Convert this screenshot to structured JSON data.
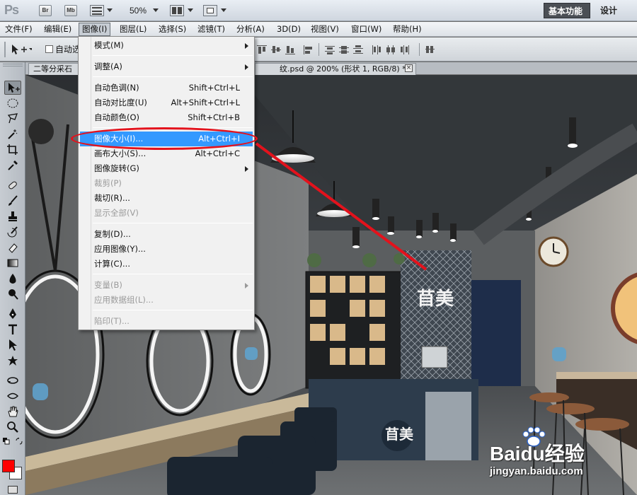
{
  "appbar": {
    "logo": "Ps",
    "bridge_label": "Br",
    "minibridge_label": "Mb",
    "zoom_level": "50%",
    "workspace_active": "基本功能",
    "workspace_other": "设计"
  },
  "menubar": {
    "items": [
      {
        "label": "文件(F)"
      },
      {
        "label": "编辑(E)"
      },
      {
        "label": "图像(I)"
      },
      {
        "label": "图层(L)"
      },
      {
        "label": "选择(S)"
      },
      {
        "label": "滤镜(T)"
      },
      {
        "label": "分析(A)"
      },
      {
        "label": "3D(D)"
      },
      {
        "label": "视图(V)"
      },
      {
        "label": "窗口(W)"
      },
      {
        "label": "帮助(H)"
      }
    ]
  },
  "options_bar": {
    "autoselect_label": "自动选"
  },
  "tabs": {
    "tab1_label": "二等分采石",
    "tab2_label": "纹.psd @ 200% (形状 1, RGB/8) *",
    "close_glyph": "×"
  },
  "image_menu": {
    "items": [
      {
        "label": "模式(M)",
        "shortcut": "",
        "submenu": true,
        "disabled": false
      },
      {
        "label": "调整(A)",
        "shortcut": "",
        "submenu": true,
        "disabled": false
      },
      {
        "label": "自动色调(N)",
        "shortcut": "Shift+Ctrl+L",
        "submenu": false,
        "disabled": false
      },
      {
        "label": "自动对比度(U)",
        "shortcut": "Alt+Shift+Ctrl+L",
        "submenu": false,
        "disabled": false
      },
      {
        "label": "自动颜色(O)",
        "shortcut": "Shift+Ctrl+B",
        "submenu": false,
        "disabled": false
      },
      {
        "label": "图像大小(I)...",
        "shortcut": "Alt+Ctrl+I",
        "submenu": false,
        "disabled": false,
        "highlighted": true
      },
      {
        "label": "画布大小(S)...",
        "shortcut": "Alt+Ctrl+C",
        "submenu": false,
        "disabled": false
      },
      {
        "label": "图像旋转(G)",
        "shortcut": "",
        "submenu": true,
        "disabled": false
      },
      {
        "label": "裁剪(P)",
        "shortcut": "",
        "submenu": false,
        "disabled": true
      },
      {
        "label": "裁切(R)...",
        "shortcut": "",
        "submenu": false,
        "disabled": false
      },
      {
        "label": "显示全部(V)",
        "shortcut": "",
        "submenu": false,
        "disabled": true
      },
      {
        "label": "复制(D)...",
        "shortcut": "",
        "submenu": false,
        "disabled": false
      },
      {
        "label": "应用图像(Y)...",
        "shortcut": "",
        "submenu": false,
        "disabled": false
      },
      {
        "label": "计算(C)...",
        "shortcut": "",
        "submenu": false,
        "disabled": false
      },
      {
        "label": "变量(B)",
        "shortcut": "",
        "submenu": true,
        "disabled": true
      },
      {
        "label": "应用数据组(L)...",
        "shortcut": "",
        "submenu": false,
        "disabled": true
      },
      {
        "label": "陷印(T)...",
        "shortcut": "",
        "submenu": false,
        "disabled": true
      }
    ]
  },
  "canvas": {
    "sign_text_wall": "苜美",
    "sign_text_counter": "苜美"
  },
  "toolbox": {
    "foreground_color": "#ff0000",
    "background_color": "#ffffff"
  },
  "annotation": {
    "color": "#e3121c"
  },
  "watermark": {
    "brand": "Baidu经验",
    "url": "jingyan.baidu.com"
  },
  "colors": {
    "menu_highlight": "#3399ff"
  }
}
